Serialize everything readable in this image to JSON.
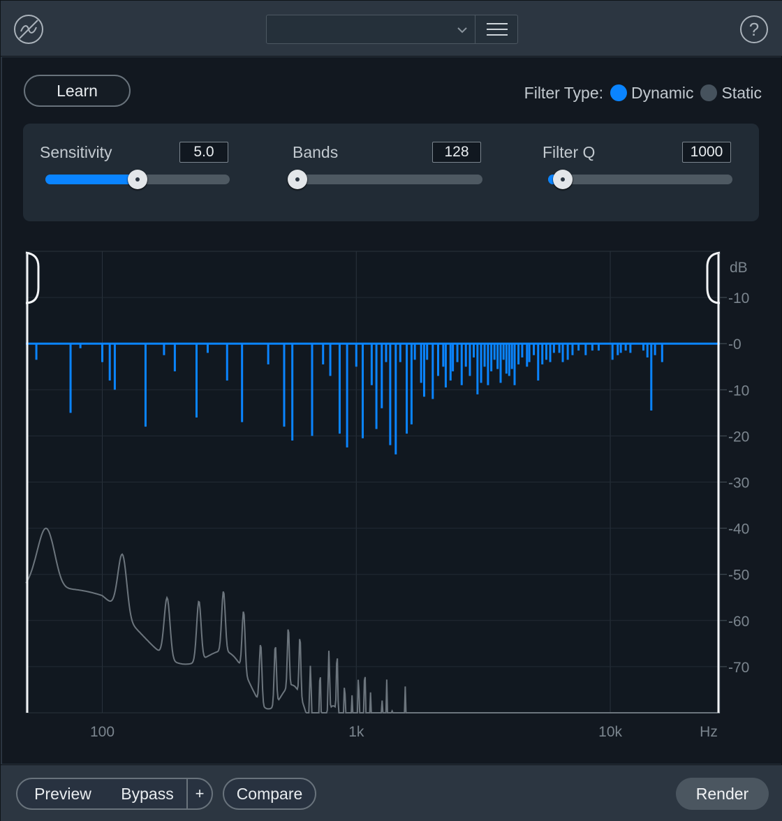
{
  "header": {
    "preset_value": "",
    "logo_icon": "de-hum-icon",
    "menu_icon": "hamburger-icon",
    "help_label": "?"
  },
  "toolbar": {
    "learn_label": "Learn",
    "filter_type_label": "Filter Type:",
    "filter_types": [
      {
        "label": "Dynamic",
        "selected": true
      },
      {
        "label": "Static",
        "selected": false
      }
    ]
  },
  "controls": {
    "sensitivity": {
      "label": "Sensitivity",
      "value": "5.0",
      "level": 0.5
    },
    "bands": {
      "label": "Bands",
      "value": "128",
      "level": 0.0
    },
    "filter_q": {
      "label": "Filter Q",
      "value": "1000",
      "level": 0.08
    }
  },
  "colors": {
    "accent": "#0a84ff",
    "background": "#121820",
    "panel": "#212b35",
    "grid": "#2a333d",
    "spectrum": "#6c757d"
  },
  "chart_data": {
    "type": "bar",
    "x_axis": {
      "unit": "Hz",
      "scale": "log",
      "ticks": [
        "100",
        "1k",
        "10k"
      ],
      "range": [
        50,
        27000
      ]
    },
    "y_axis": {
      "unit": "dB",
      "ticks": [
        "10",
        "0",
        "10",
        "20",
        "30",
        "40",
        "50",
        "60",
        "70"
      ],
      "range": [
        -80,
        20
      ]
    },
    "filter_bands": {
      "color": "#0a84ff",
      "freq_hz": [
        55,
        75,
        82,
        100,
        107,
        112,
        148,
        175,
        193,
        235,
        260,
        310,
        355,
        450,
        520,
        560,
        670,
        740,
        790,
        860,
        920,
        1000,
        1060,
        1150,
        1200,
        1260,
        1310,
        1360,
        1430,
        1490,
        1580,
        1650,
        1700,
        1800,
        1850,
        1900,
        2000,
        2100,
        2200,
        2250,
        2350,
        2400,
        2500,
        2600,
        2700,
        2800,
        2900,
        3000,
        3100,
        3200,
        3300,
        3400,
        3500,
        3600,
        3700,
        3800,
        3900,
        4000,
        4100,
        4200,
        4350,
        4500,
        4700,
        4800,
        5000,
        5200,
        5400,
        5600,
        5800,
        6000,
        6300,
        6500,
        6800,
        7100,
        7500,
        8000,
        8500,
        9000,
        10200,
        10700,
        11000,
        11500,
        12000,
        13500,
        14000,
        14500,
        15000,
        16000
      ],
      "depth_db": [
        -3.5,
        -15,
        -1,
        -4,
        -8,
        -10,
        -18,
        -2.5,
        -6,
        -16,
        -2,
        -8,
        -17,
        -4.5,
        -18,
        -21,
        -20,
        -4.5,
        -7,
        -19.5,
        -22.5,
        -5,
        -20.5,
        -9,
        -18.5,
        -14,
        -4,
        -22,
        -24,
        -4,
        -19.5,
        -17.5,
        -3.5,
        -8.5,
        -11.5,
        -3.5,
        -12,
        -7,
        -5,
        -9.5,
        -8,
        -6,
        -4,
        -9,
        -5,
        -7,
        -3,
        -11,
        -8.5,
        -5,
        -9,
        -6,
        -3.5,
        -5.5,
        -8.5,
        -3.5,
        -6.5,
        -7,
        -5.5,
        -9,
        -4.5,
        -3,
        -5,
        -4,
        -2.5,
        -8,
        -4.5,
        -3.5,
        -4,
        -2,
        -2,
        -4,
        -3.5,
        -2.5,
        -1.5,
        -2.5,
        -1.5,
        -1.5,
        -3.5,
        -2.5,
        -2,
        -1.5,
        -2,
        -1.5,
        -3,
        -14.5,
        -2.5,
        -4
      ]
    }
  },
  "footer": {
    "preview_label": "Preview",
    "bypass_label": "Bypass",
    "plus_label": "+",
    "compare_label": "Compare",
    "render_label": "Render"
  }
}
